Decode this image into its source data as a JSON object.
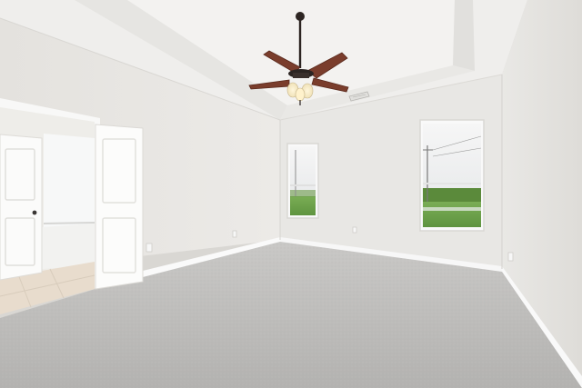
{
  "scene": {
    "subject": "empty-bedroom",
    "colors": {
      "wall_light": "#ecebe8",
      "wall_shade": "#dcdad6",
      "ceiling": "#f1f0ee",
      "carpet": "#bdbcba",
      "trim": "#fafafa",
      "fan_blade": "#7a3d2c",
      "fan_body": "#2c2522",
      "sky": "#f3f3f3",
      "grass": "#6fa24d",
      "trees": "#5b8a3b",
      "tile": "#e6ddd0"
    },
    "icons": [
      "ceiling-fan-icon",
      "window-icon",
      "door-icon",
      "air-vent-icon",
      "outlet-icon"
    ]
  }
}
